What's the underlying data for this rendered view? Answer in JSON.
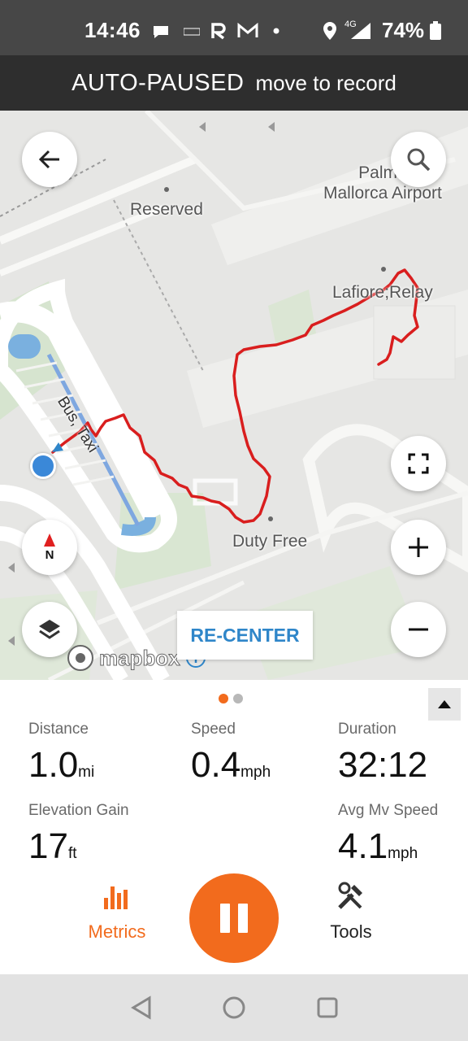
{
  "status_bar": {
    "time": "14:46",
    "battery": "74%",
    "network": "4G",
    "icons": [
      "chat-bubble-icon",
      "mse-icon",
      "r-app-icon",
      "gmail-icon",
      "dot-icon",
      "location-pin-icon",
      "signal-icon",
      "battery-icon"
    ]
  },
  "banner": {
    "status": "AUTO-PAUSED",
    "hint": "move to record"
  },
  "map": {
    "labels": {
      "airport": "Palma\nMallorca Airport",
      "reserved": "Reserved",
      "shop": "Lafiore;Relay",
      "duty_free": "Duty Free",
      "bus": "Bus, Taxi"
    },
    "recenter_label": "RE-CENTER",
    "compass_label": "N",
    "attribution": "mapbox",
    "track_color": "#d91e1e",
    "location_color": "#2f86c9"
  },
  "metrics": {
    "page_indicator": {
      "pages": 2,
      "active": 1
    },
    "items": [
      {
        "label": "Distance",
        "value": "1.0",
        "unit": "mi"
      },
      {
        "label": "Speed",
        "value": "0.4",
        "unit": "mph"
      },
      {
        "label": "Duration",
        "value": "32:12",
        "unit": ""
      },
      {
        "label": "Elevation Gain",
        "value": "17",
        "unit": "ft"
      },
      {
        "label": "Avg Mv Speed",
        "value": "4.1",
        "unit": "mph"
      }
    ]
  },
  "tabs": {
    "metrics_label": "Metrics",
    "tools_label": "Tools"
  },
  "colors": {
    "accent": "#f26b1d",
    "banner_bg": "#2e2e2e",
    "status_bg": "#474747"
  }
}
